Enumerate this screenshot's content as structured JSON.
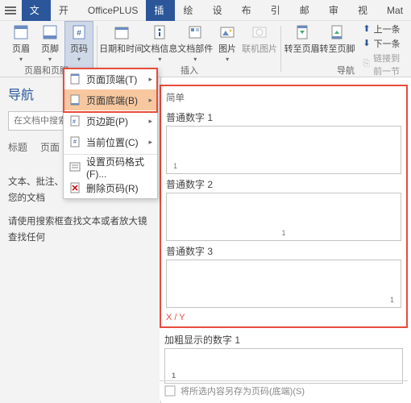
{
  "tabs": [
    "文件",
    "开始",
    "OfficePLUS",
    "插入",
    "绘图",
    "设计",
    "布局",
    "引用",
    "邮件",
    "审阅",
    "视图",
    "Mat"
  ],
  "active_tab_index": 3,
  "ribbon": {
    "header": {
      "label": "页眉"
    },
    "footer": {
      "label": "页脚"
    },
    "pagenum": {
      "label": "页码"
    },
    "datetime": {
      "label": "日期和时间"
    },
    "docinfo": {
      "label": "文档信息"
    },
    "docparts": {
      "label": "文档部件"
    },
    "picture": {
      "label": "图片"
    },
    "online_pic": {
      "label": "联机图片"
    },
    "goto_header": {
      "label": "转至页眉"
    },
    "goto_footer": {
      "label": "转至页脚"
    },
    "prev": {
      "label": "上一条"
    },
    "next": {
      "label": "下一条"
    },
    "link_prev": {
      "label": "链接到前一节"
    },
    "grp_hf": "页眉和页脚",
    "grp_insert": "插入",
    "grp_nav": "导航"
  },
  "nav": {
    "title": "导航",
    "search_placeholder": "在文档中搜索",
    "tab1": "标题",
    "tab2": "页面",
    "help1": "文本、批注、图片...Word 可以查找您的文档",
    "help2": "请使用搜索框查找文本或者放大镜查找任何"
  },
  "dropdown": {
    "items": [
      {
        "label": "页面顶端(T)",
        "arrow": true
      },
      {
        "label": "页面底端(B)",
        "arrow": true,
        "hl": true
      },
      {
        "label": "页边距(P)",
        "arrow": true
      },
      {
        "label": "当前位置(C)",
        "arrow": true
      },
      {
        "label": "设置页码格式(F)...",
        "arrow": false
      },
      {
        "label": "删除页码(R)",
        "arrow": false
      }
    ]
  },
  "gallery": {
    "simple": "简单",
    "items": [
      "普通数字 1",
      "普通数字 2",
      "普通数字 3"
    ],
    "xy": "X / Y",
    "bold": "加粗显示的数字 1",
    "footer": "将所选内容另存为页码(底端)(S)"
  }
}
